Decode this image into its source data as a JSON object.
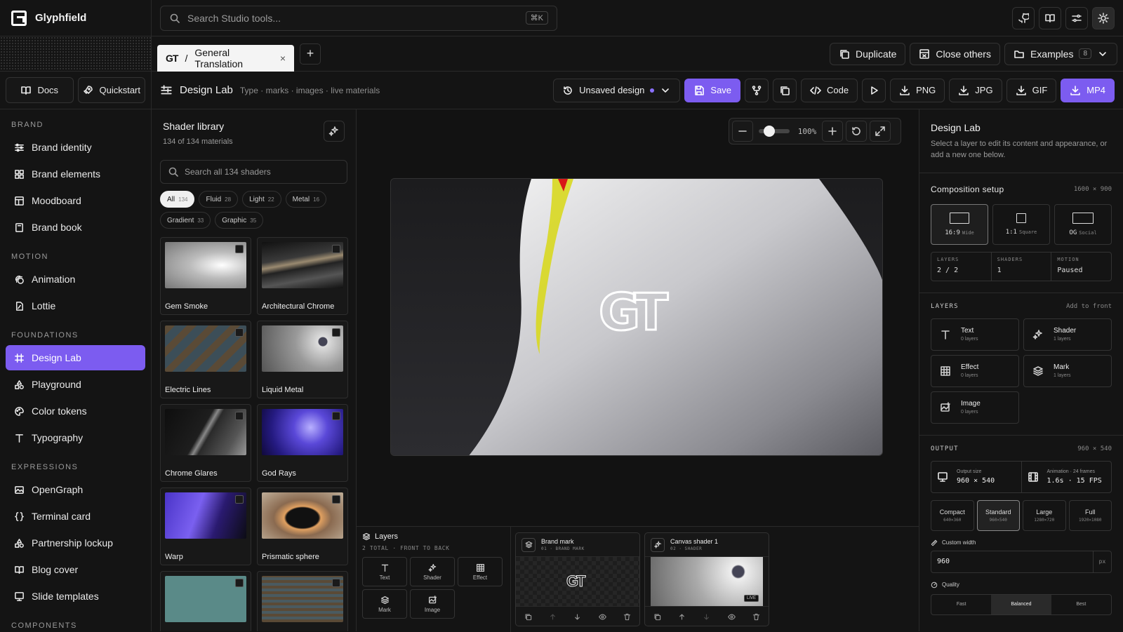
{
  "app": {
    "name": "Glyphfield"
  },
  "sidebar": {
    "docs_label": "Docs",
    "quickstart_label": "Quickstart",
    "sections": {
      "brand": "BRAND",
      "motion": "MOTION",
      "foundations": "FOUNDATIONS",
      "expressions": "EXPRESSIONS",
      "components": "COMPONENTS"
    },
    "items": {
      "brand_identity": "Brand identity",
      "brand_elements": "Brand elements",
      "moodboard": "Moodboard",
      "brand_book": "Brand book",
      "animation": "Animation",
      "lottie": "Lottie",
      "design_lab": "Design Lab",
      "playground": "Playground",
      "color_tokens": "Color tokens",
      "typography": "Typography",
      "opengraph": "OpenGraph",
      "terminal_card": "Terminal card",
      "partnership_lockup": "Partnership lockup",
      "blog_cover": "Blog cover",
      "slide_templates": "Slide templates"
    }
  },
  "topbar": {
    "search_placeholder": "Search Studio tools...",
    "shortcut": "⌘K"
  },
  "tabs": {
    "active": {
      "logo": "GT",
      "separator": "/",
      "label": "General Translation",
      "close": "×"
    },
    "new_tab": "+",
    "duplicate": "Duplicate",
    "close_others": "Close others",
    "examples": "Examples",
    "examples_count": "8"
  },
  "toolbar": {
    "title": "Design Lab",
    "crumbs": "Type · marks · images · live materials",
    "unsaved": "Unsaved design",
    "save": "Save",
    "code": "Code",
    "png": "PNG",
    "jpg": "JPG",
    "gif": "GIF",
    "mp4": "MP4"
  },
  "library": {
    "title": "Shader library",
    "subtitle": "134 of 134 materials",
    "search_placeholder": "Search all 134 shaders",
    "chips": [
      {
        "label": "All",
        "count": "134"
      },
      {
        "label": "Fluid",
        "count": "28"
      },
      {
        "label": "Light",
        "count": "22"
      },
      {
        "label": "Metal",
        "count": "16"
      },
      {
        "label": "Gradient",
        "count": "33"
      },
      {
        "label": "Graphic",
        "count": "35"
      }
    ],
    "cards": [
      "Gem Smoke",
      "Architectural Chrome",
      "Electric Lines",
      "Liquid Metal",
      "Chrome Glares",
      "God Rays",
      "Warp",
      "Prismatic sphere"
    ]
  },
  "canvas": {
    "zoom": "100%",
    "zoom_level": 0.25,
    "mark": "GT"
  },
  "layers_strip": {
    "title": "Layers",
    "subtitle": "2 TOTAL · FRONT TO BACK",
    "add": [
      "Text",
      "Shader",
      "Effect",
      "Mark",
      "Image"
    ],
    "cards": [
      {
        "name": "Brand mark",
        "meta": "01 · BRAND MARK",
        "preview_text": "GT"
      },
      {
        "name": "Canvas shader 1",
        "meta": "02 · SHADER",
        "badge": "LIVE"
      }
    ]
  },
  "panel": {
    "title": "Design Lab",
    "description": "Select a layer to edit its content and appearance, or add a new one below.",
    "composition": {
      "title": "Composition setup",
      "size": "1600 × 900",
      "aspects": [
        {
          "label": "16:9",
          "sub": "Wide"
        },
        {
          "label": "1:1",
          "sub": "Square"
        },
        {
          "label": "OG",
          "sub": "Social"
        }
      ],
      "stats": [
        {
          "k": "LAYERS",
          "v": "2 / 2"
        },
        {
          "k": "SHADERS",
          "v": "1"
        },
        {
          "k": "MOTION",
          "v": "Paused"
        }
      ]
    },
    "layers": {
      "title": "LAYERS",
      "action": "Add to front",
      "items": [
        {
          "name": "Text",
          "sub": "0 layers"
        },
        {
          "name": "Shader",
          "sub": "1 layers"
        },
        {
          "name": "Effect",
          "sub": "0 layers"
        },
        {
          "name": "Mark",
          "sub": "1 layers"
        },
        {
          "name": "Image",
          "sub": "0 layers"
        }
      ]
    },
    "output": {
      "title": "OUTPUT",
      "size": "960 × 540",
      "output_size_k": "Output size",
      "output_size_v": "960 × 540",
      "animation_k": "Animation · 24 frames",
      "animation_v": "1.6s · 15 FPS",
      "presets": [
        {
          "a": "Compact",
          "b": "640×360"
        },
        {
          "a": "Standard",
          "b": "960×540"
        },
        {
          "a": "Large",
          "b": "1280×720"
        },
        {
          "a": "Full",
          "b": "1920×1080"
        }
      ],
      "custom_width_label": "Custom width",
      "custom_width_value": "960",
      "custom_width_unit": "px",
      "quality_label": "Quality",
      "quality_options": [
        "Fast",
        "Balanced",
        "Best"
      ]
    }
  }
}
